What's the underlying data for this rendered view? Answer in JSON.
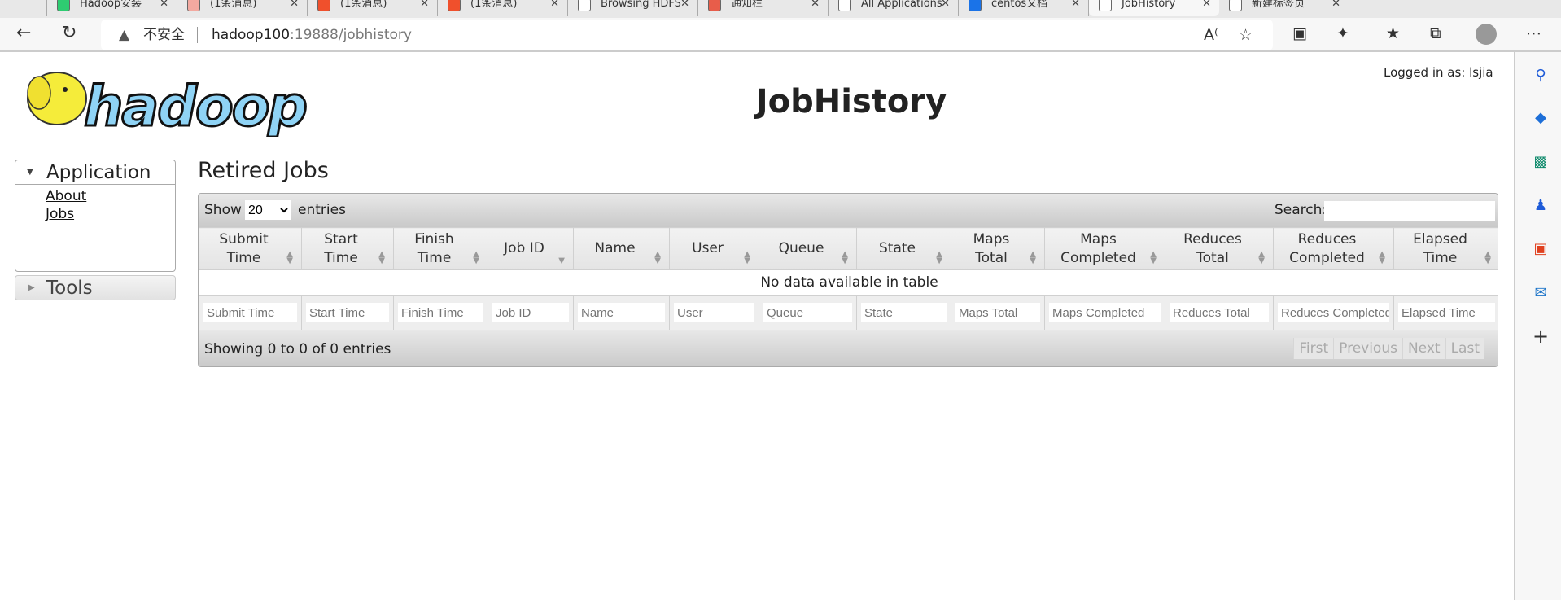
{
  "browser": {
    "tabs": [
      {
        "title": "Hadoop安装",
        "color": "#2ecc71"
      },
      {
        "title": "(1条消息)",
        "color": "#f3a9a0"
      },
      {
        "title": "(1条消息)",
        "color": "#f0502c"
      },
      {
        "title": "(1条消息)",
        "color": "#f0502c"
      },
      {
        "title": "Browsing HDFS",
        "color": "#ffffff"
      },
      {
        "title": "通知栏",
        "color": "#e85d4a"
      },
      {
        "title": "All Applications",
        "color": "#ffffff"
      },
      {
        "title": "centos文档",
        "color": "#1a73e8"
      },
      {
        "title": "JobHistory",
        "color": "#ffffff",
        "active": true
      },
      {
        "title": "新建标签页",
        "color": "#ffffff"
      }
    ],
    "address": {
      "warning": "不安全",
      "host": "hadoop100",
      "path": ":19888/jobhistory"
    },
    "sidebar_icons": [
      "search-icon",
      "tag-icon",
      "toolbox-icon",
      "games-icon",
      "office-icon",
      "outlook-icon",
      "add-icon"
    ]
  },
  "header": {
    "logo_text": "hadoop",
    "title": "JobHistory",
    "login": "Logged in as: lsjia"
  },
  "nav": {
    "application": {
      "label": "Application",
      "links": [
        "About",
        "Jobs"
      ]
    },
    "tools": {
      "label": "Tools"
    }
  },
  "main": {
    "heading": "Retired Jobs",
    "show_label": "Show",
    "page_size": "20",
    "entries_label": "entries",
    "search_label": "Search:",
    "search_value": "",
    "columns": [
      "Submit Time",
      "Start Time",
      "Finish Time",
      "Job ID",
      "Name",
      "User",
      "Queue",
      "State",
      "Maps Total",
      "Maps Completed",
      "Reduces Total",
      "Reduces Completed",
      "Elapsed Time"
    ],
    "sorted_column": "Job ID",
    "empty_message": "No data available in table",
    "info": "Showing 0 to 0 of 0 entries",
    "pager": [
      "First",
      "Previous",
      "Next",
      "Last"
    ]
  }
}
